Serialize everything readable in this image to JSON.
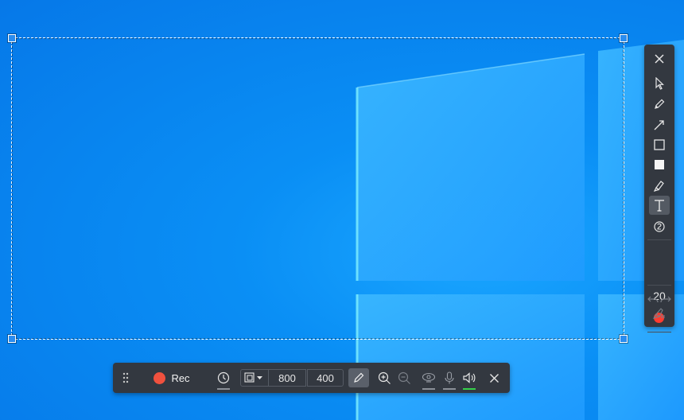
{
  "desktop": {
    "wallpaper_icon": "windows-logo-icon"
  },
  "side_toolbar": {
    "tools": [
      {
        "icon": "close-icon",
        "active": false
      },
      {
        "icon": "cursor-icon",
        "active": false
      },
      {
        "icon": "pen-icon",
        "active": false
      },
      {
        "icon": "arrow-icon",
        "active": false
      },
      {
        "icon": "rectangle-outline-icon",
        "active": false
      },
      {
        "icon": "rectangle-filled-icon",
        "active": false
      },
      {
        "icon": "highlighter-icon",
        "active": false
      },
      {
        "icon": "text-icon",
        "active": true
      },
      {
        "icon": "number-marker-icon",
        "active": false
      }
    ],
    "size": "20",
    "color": "#ff3b2f",
    "undo_icon": "undo-icon",
    "redo_icon": "redo-icon",
    "clear_icon": "clear-all-icon"
  },
  "bottom_bar": {
    "drag_icon": "drag-handle-icon",
    "record_label": "Rec",
    "record_color": "#f0513e",
    "timer_icon": "timer-icon",
    "aspect_icon": "aspect-ratio-icon",
    "width": "800",
    "height": "400",
    "draw_icon": "pen-icon",
    "zoom_in_icon": "zoom-in-icon",
    "zoom_out_icon": "zoom-out-icon",
    "webcam_icon": "webcam-icon",
    "mic_icon": "microphone-icon",
    "speaker_icon": "speaker-icon",
    "close_icon": "close-icon",
    "speaker_active_color": "#35d04a"
  }
}
